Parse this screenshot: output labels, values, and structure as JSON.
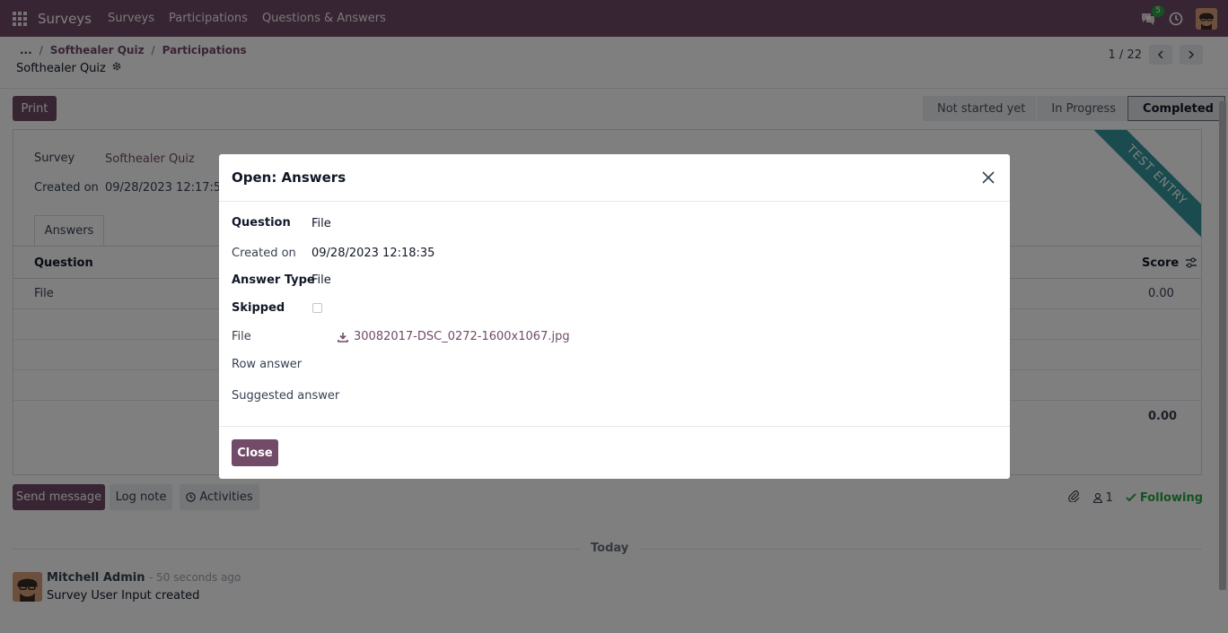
{
  "navbar": {
    "brand": "Surveys",
    "menu": [
      "Surveys",
      "Participations",
      "Questions & Answers"
    ],
    "chat_badge": "5"
  },
  "breadcrumb": {
    "dots": "...",
    "items": [
      "Softhealer Quiz",
      "Participations"
    ]
  },
  "record_title": "Softhealer Quiz",
  "pager": {
    "value": "1 / 22"
  },
  "form": {
    "print_label": "Print",
    "statuses": [
      "Not started yet",
      "In Progress",
      "Completed"
    ],
    "active_status": "Completed",
    "ribbon": "TEST ENTRY",
    "survey_label": "Survey",
    "survey_value": "Softhealer Quiz",
    "created_label": "Created on",
    "created_value": "09/28/2023 12:17:58",
    "tab_answers": "Answers",
    "col_question": "Question",
    "col_score": "Score",
    "rows": [
      {
        "question": "File",
        "score": "0.00"
      }
    ],
    "total_score": "0.00"
  },
  "chatter": {
    "send_label": "Send message",
    "log_label": "Log note",
    "activities_label": "Activities",
    "followers": "1",
    "following": "Following",
    "today": "Today",
    "author": "Mitchell Admin",
    "time": "- 50 seconds ago",
    "body": "Survey User Input created"
  },
  "modal": {
    "title": "Open: Answers",
    "question_label": "Question",
    "question_value": "File",
    "created_label": "Created on",
    "created_value": "09/28/2023 12:18:35",
    "answer_type_label": "Answer Type",
    "answer_type_value": "File",
    "skipped_label": "Skipped",
    "file_label": "File",
    "file_name": "30082017-DSC_0272-1600x1067.jpg",
    "row_answer_label": "Row answer",
    "suggested_label": "Suggested answer",
    "close_label": "Close"
  },
  "colors": {
    "brand": "#714B67",
    "ribbon": "#35979c",
    "following": "#28a745"
  }
}
